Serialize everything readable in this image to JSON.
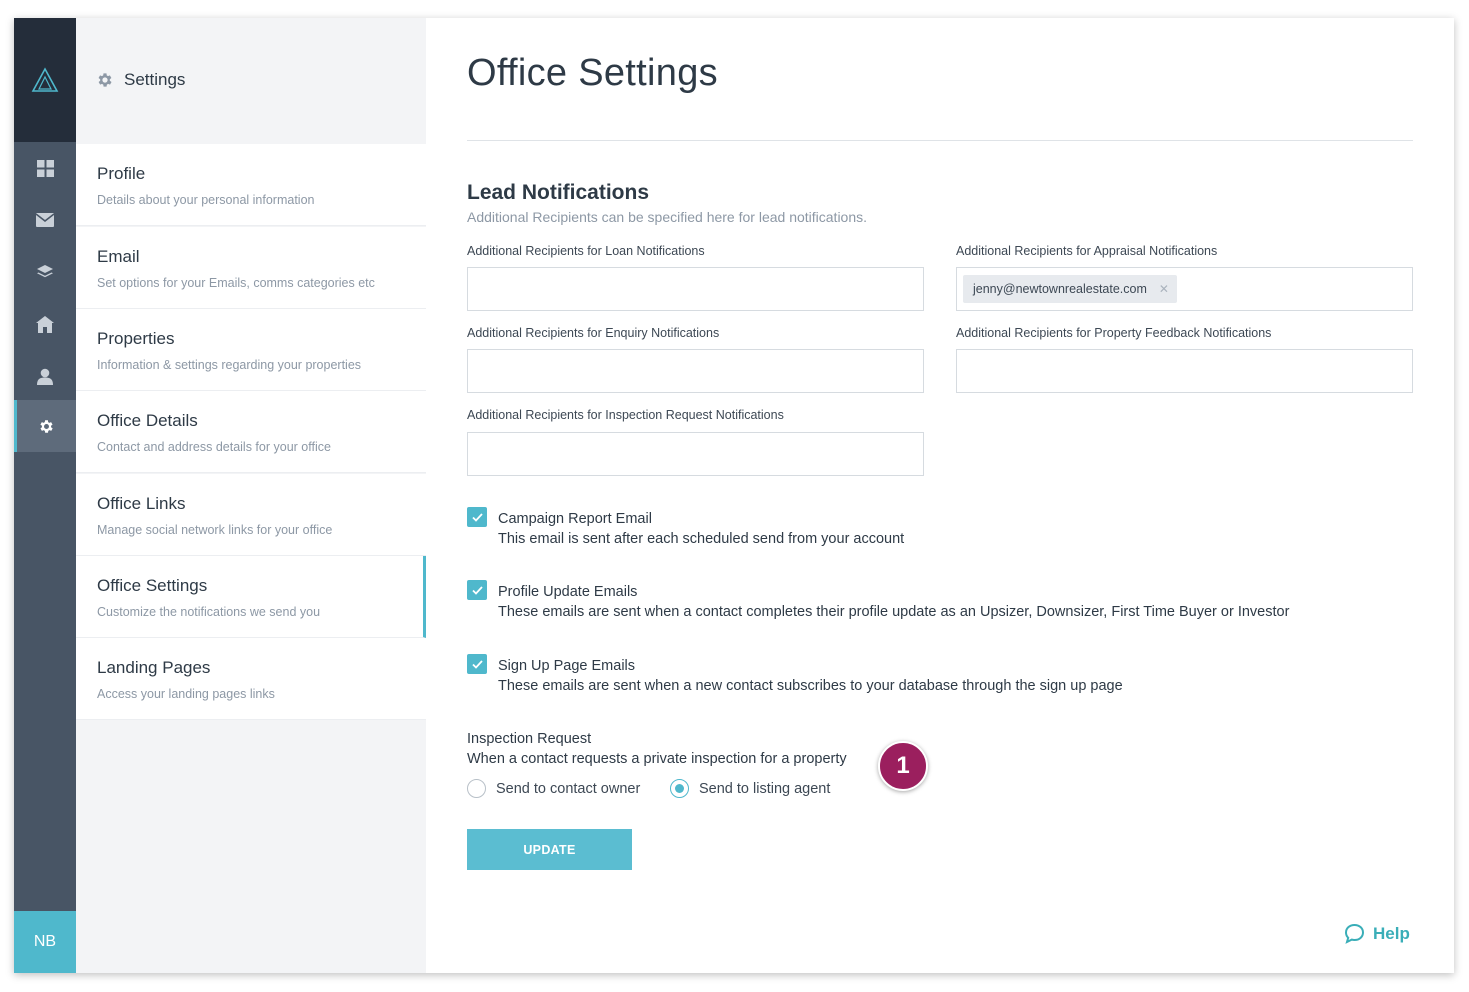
{
  "rail": {
    "avatar_initials": "NB",
    "icons": [
      "logo-icon",
      "dashboard-icon",
      "mail-icon",
      "layers-icon",
      "home-icon",
      "user-icon",
      "gear-icon"
    ]
  },
  "menu": {
    "title": "Settings",
    "items": [
      {
        "title": "Profile",
        "desc": "Details about your personal information"
      },
      {
        "title": "Email",
        "desc": "Set options for your Emails, comms categories etc"
      },
      {
        "title": "Properties",
        "desc": "Information & settings regarding your properties"
      },
      {
        "title": "Office Details",
        "desc": "Contact and address details for your office"
      },
      {
        "title": "Office Links",
        "desc": "Manage social network links for your office"
      },
      {
        "title": "Office Settings",
        "desc": "Customize the notifications we send you"
      },
      {
        "title": "Landing Pages",
        "desc": "Access your landing pages links"
      }
    ],
    "active_index": 5
  },
  "main": {
    "page_title": "Office Settings",
    "section_title": "Lead Notifications",
    "section_subtitle": "Additional Recipients can be specified here for lead notifications.",
    "fields": {
      "loan": {
        "label": "Additional Recipients for Loan Notifications",
        "value": ""
      },
      "appraisal": {
        "label": "Additional Recipients for Appraisal Notifications",
        "tags": [
          "jenny@newtownrealestate.com"
        ]
      },
      "enquiry": {
        "label": "Additional Recipients for Enquiry Notifications",
        "value": ""
      },
      "feedback": {
        "label": "Additional Recipients for Property Feedback Notifications",
        "value": ""
      },
      "inspection": {
        "label": "Additional Recipients for Inspection Request Notifications",
        "value": ""
      }
    },
    "checkboxes": [
      {
        "title": "Campaign Report Email",
        "desc": "This email is sent after each scheduled send from your account",
        "checked": true
      },
      {
        "title": "Profile Update Emails",
        "desc": "These emails are sent when a contact completes their profile update as an Upsizer, Downsizer, First Time Buyer or Investor",
        "checked": true
      },
      {
        "title": "Sign Up Page Emails",
        "desc": "These emails are sent when a new contact subscribes to your database through the sign up page",
        "checked": true
      }
    ],
    "inspection_request": {
      "title": "Inspection Request",
      "subtitle": "When a contact requests a private inspection for a property",
      "options": [
        "Send to contact owner",
        "Send to listing agent"
      ],
      "selected": "Send to listing agent"
    },
    "marker_number": "1",
    "update_label": "UPDATE",
    "help_label": "Help"
  },
  "colors": {
    "accent": "#4fb8cc",
    "rail_dark": "#242d3a",
    "rail": "#485565",
    "marker": "#9b1f5e",
    "help": "#3aaeb8"
  }
}
